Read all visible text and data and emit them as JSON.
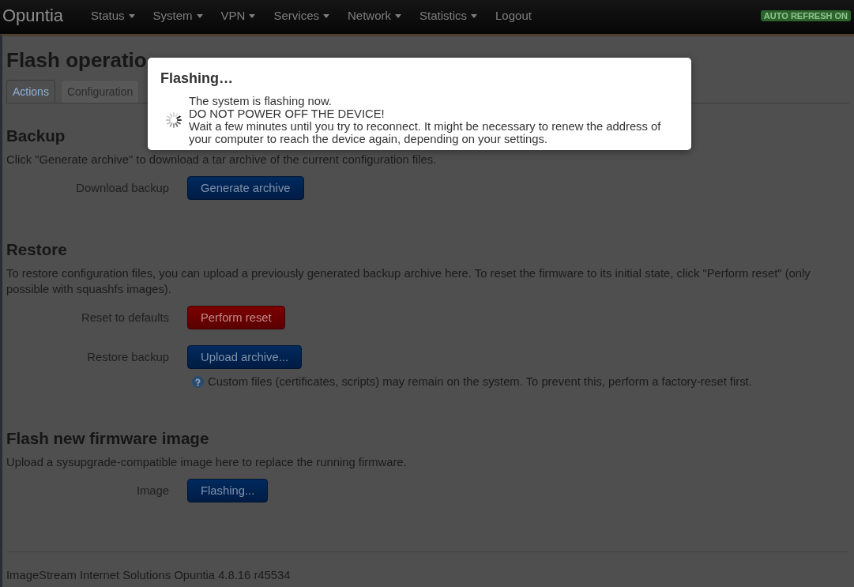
{
  "navbar": {
    "brand": "Opuntia",
    "menu": [
      {
        "label": "Status",
        "dropdown": true
      },
      {
        "label": "System",
        "dropdown": true
      },
      {
        "label": "VPN",
        "dropdown": true
      },
      {
        "label": "Services",
        "dropdown": true
      },
      {
        "label": "Network",
        "dropdown": true
      },
      {
        "label": "Statistics",
        "dropdown": true
      },
      {
        "label": "Logout",
        "dropdown": false
      }
    ],
    "badge": "AUTO REFRESH ON"
  },
  "page": {
    "title": "Flash operatio",
    "tabs": [
      {
        "label": "Actions",
        "selected": true
      },
      {
        "label": "Configuration",
        "selected": false
      }
    ]
  },
  "sections": [
    {
      "title": "Backup",
      "description": "Click \"Generate archive\" to download a tar archive of the current configuration files.",
      "rows": [
        {
          "label": "Download backup",
          "button": {
            "label": "Generate archive",
            "kind": "primary"
          }
        }
      ]
    },
    {
      "title": "Restore",
      "description": "To restore configuration files, you can upload a previously generated backup archive here. To reset the firmware to its initial state, click \"Perform reset\" (only possible with squashfs images).",
      "rows": [
        {
          "label": "Reset to defaults",
          "button": {
            "label": "Perform reset",
            "kind": "danger"
          }
        },
        {
          "label": "Restore backup",
          "button": {
            "label": "Upload archive...",
            "kind": "primary"
          },
          "help": "Custom files (certificates, scripts) may remain on the system. To prevent this, perform a factory-reset first."
        }
      ]
    },
    {
      "title": "Flash new firmware image",
      "description": "Upload a sysupgrade-compatible image here to replace the running firmware.",
      "rows": [
        {
          "label": "Image",
          "button": {
            "label": "Flashing...",
            "kind": "primary"
          }
        }
      ]
    }
  ],
  "footer": "ImageStream Internet Solutions Opuntia 4.8.16 r45534",
  "modal": {
    "title": "Flashing…",
    "lines": [
      "The system is flashing now.",
      "DO NOT POWER OFF THE DEVICE!",
      "Wait a few minutes until you try to reconnect. It might be necessary to renew the address of your computer to reach the device again, depending on your settings."
    ]
  }
}
